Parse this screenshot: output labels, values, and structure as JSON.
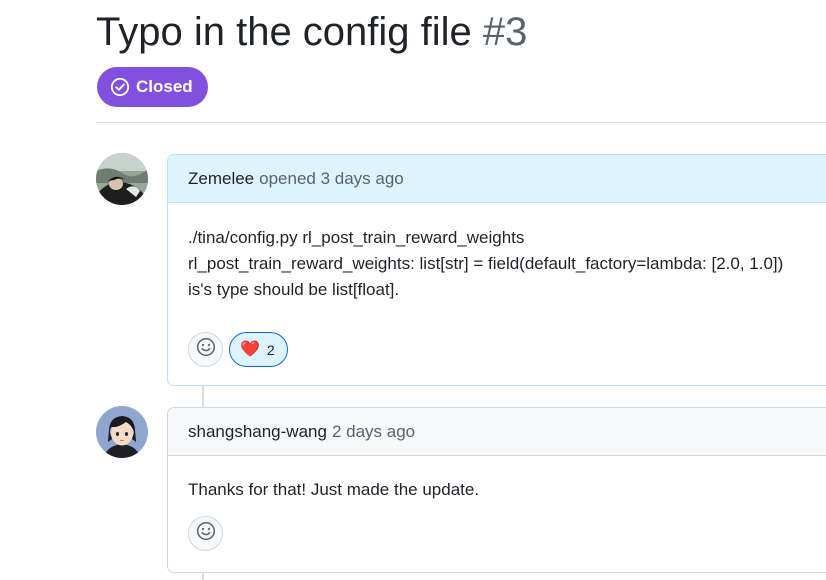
{
  "issue": {
    "title": "Typo in the config file",
    "number": "#3",
    "state": "Closed",
    "state_color": "#8250df"
  },
  "comments": [
    {
      "author": "Zemelee",
      "meta": "opened 3 days ago",
      "body_lines": [
        "./tina/config.py rl_post_train_reward_weights",
        "rl_post_train_reward_weights: list[str] = field(default_factory=lambda: [2.0, 1.0])",
        "is's type should be list[float]."
      ],
      "reactions": [
        {
          "emoji": "❤️",
          "count": "2"
        }
      ]
    },
    {
      "author": "shangshang-wang",
      "meta": "2 days ago",
      "body_lines": [
        "Thanks for that! Just made the update."
      ],
      "reactions": []
    }
  ]
}
